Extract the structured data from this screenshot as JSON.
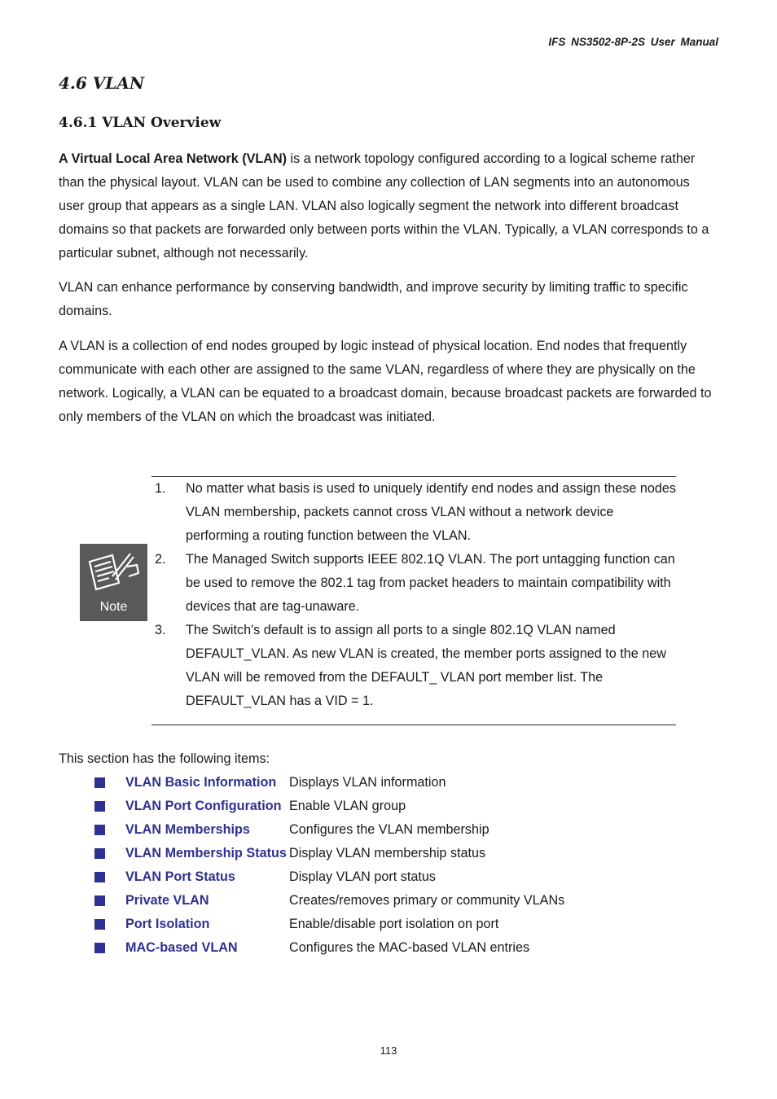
{
  "header": {
    "manual_title": "IFS  NS3502-8P-2S  User  Manual"
  },
  "section": {
    "title": "4.6 VLAN"
  },
  "subsection": {
    "title": "4.6.1 VLAN Overview"
  },
  "paragraphs": {
    "p1_bold": "A Virtual Local Area Network (VLAN)",
    "p1_rest": " is a network topology configured according to a logical scheme rather than the physical layout. VLAN can be used to combine any collection of LAN segments into an autonomous user group that appears as a single LAN. VLAN also logically segment the network into different broadcast domains so that packets are forwarded only between ports within the VLAN. Typically, a VLAN corresponds to a particular subnet, although not necessarily.",
    "p2": "VLAN can enhance performance by conserving bandwidth, and improve security by limiting traffic to specific domains.",
    "p3": "A VLAN is a collection of end nodes grouped by logic instead of physical location. End nodes that frequently communicate with each other are assigned to the same VLAN, regardless of where they are physically on the network. Logically, a VLAN can be equated to a broadcast domain, because broadcast packets are forwarded to only members of the VLAN on which the broadcast was initiated."
  },
  "note": {
    "icon_label": "Note",
    "items": [
      {
        "num": "1.",
        "text": "No matter what basis is used to uniquely identify end nodes and assign these nodes VLAN membership, packets cannot cross VLAN without a network device performing a routing function between the VLAN."
      },
      {
        "num": "2.",
        "text": "The Managed Switch supports IEEE 802.1Q VLAN. The port untagging function can be used to remove the 802.1 tag from packet headers to maintain compatibility with devices that are tag-unaware."
      },
      {
        "num": "3.",
        "text": "The Switch's default is to assign all ports to a single 802.1Q VLAN named DEFAULT_VLAN. As new VLAN is created, the member ports assigned to the new VLAN will be removed from the DEFAULT_ VLAN port member list. The DEFAULT_VLAN has a VID = 1."
      }
    ]
  },
  "items_intro": "This section has the following items:",
  "items": [
    {
      "name": "VLAN Basic Information",
      "desc": "Displays VLAN information"
    },
    {
      "name": "VLAN Port Configuration",
      "desc": "Enable VLAN group"
    },
    {
      "name": "VLAN Memberships",
      "desc": "Configures the VLAN membership"
    },
    {
      "name": "VLAN Membership Status",
      "desc": "Display VLAN membership status"
    },
    {
      "name": "VLAN Port Status",
      "desc": "Display VLAN port status"
    },
    {
      "name": "Private VLAN",
      "desc": "Creates/removes primary or community VLANs"
    },
    {
      "name": "Port Isolation",
      "desc": "Enable/disable port isolation on port"
    },
    {
      "name": "MAC-based VLAN",
      "desc": "Configures the MAC-based VLAN entries"
    }
  ],
  "colors": {
    "link": "#2e3192",
    "note_icon_bg": "#595959"
  },
  "footer": {
    "page_number": "113"
  }
}
